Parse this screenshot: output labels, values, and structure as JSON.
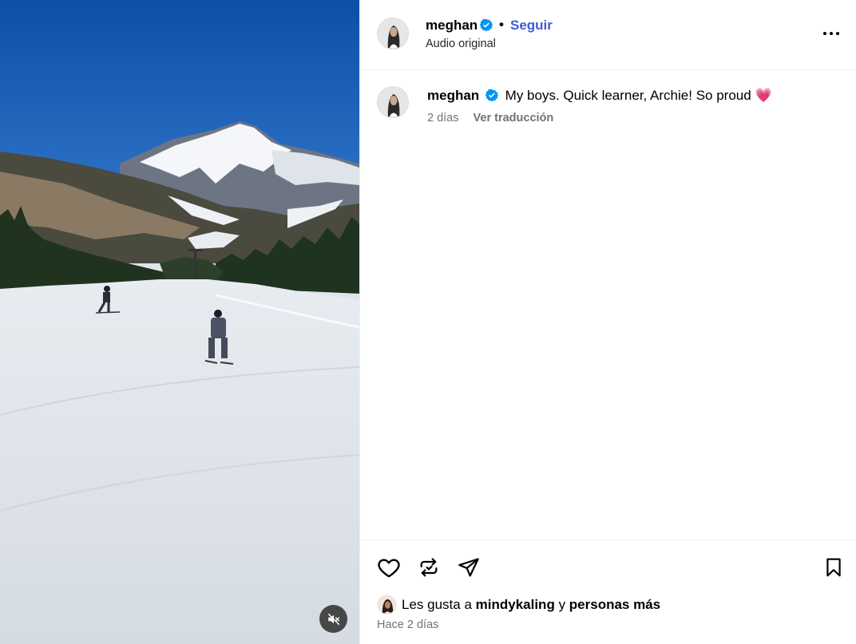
{
  "header": {
    "username": "meghan",
    "dot": "•",
    "follow_label": "Seguir",
    "audio_label": "Audio original"
  },
  "caption": {
    "username": "meghan",
    "text": "My boys. Quick learner, Archie! So proud",
    "emoji": "💗",
    "time_ago": "2 días",
    "translate_label": "Ver traducción"
  },
  "likes": {
    "prefix": "Les gusta a",
    "liker": "mindykaling",
    "connector": "y",
    "others": "personas más"
  },
  "post_date": "Hace 2 días",
  "icons": {
    "verified": "verified-badge-icon",
    "more": "more-options-icon",
    "like": "heart-icon",
    "repost": "repost-icon",
    "share": "paper-plane-icon",
    "save": "bookmark-icon",
    "mute": "muted-speaker-icon"
  },
  "colors": {
    "follow": "#3f5bd6",
    "verified": "#0095f6",
    "muted_text": "#737373",
    "divider": "#efefef"
  }
}
